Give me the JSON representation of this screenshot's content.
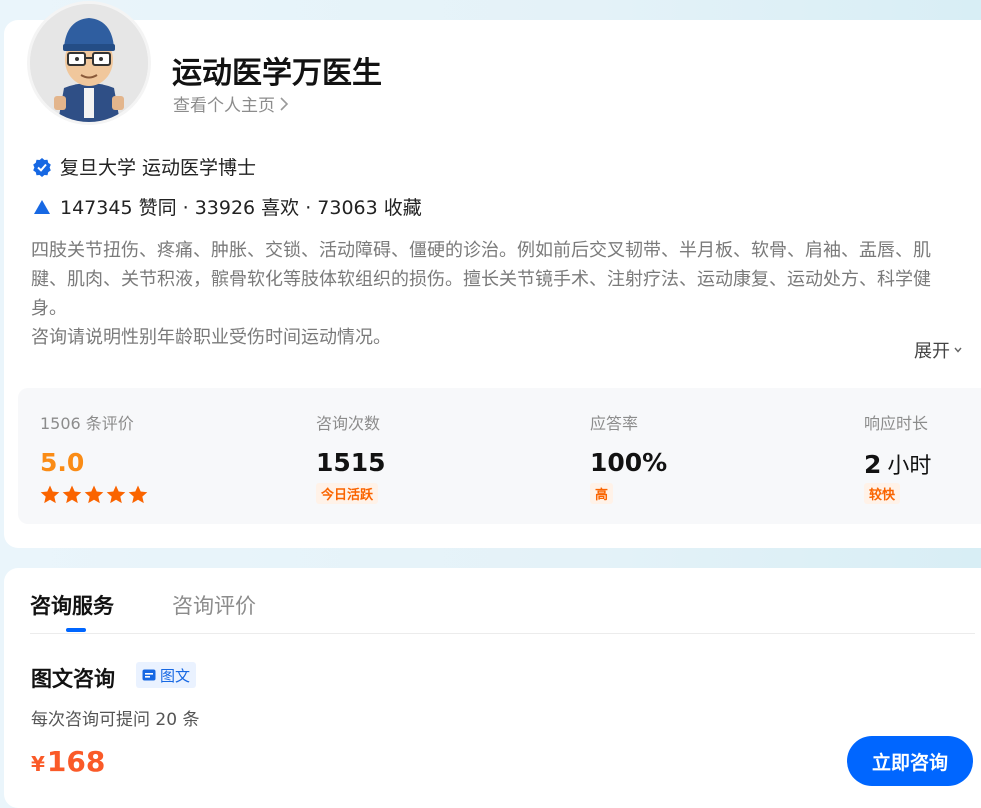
{
  "profile": {
    "name": "运动医学万医生",
    "homepage_link": "查看个人主页",
    "credential": "复旦大学 运动医学博士",
    "stats_line": "147345 赞同 · 33926 喜欢 · 73063 收藏",
    "description": "四肢关节扭伤、疼痛、肿胀、交锁、活动障碍、僵硬的诊治。例如前后交叉韧带、半月板、软骨、肩袖、盂唇、肌腱、肌肉、关节积液，髌骨软化等肢体软组织的损伤。擅长关节镜手术、注射疗法、运动康复、运动处方、科学健身。",
    "note": "咨询请说明性别年龄职业受伤时间运动情况。",
    "expand_label": "展开"
  },
  "stats": {
    "reviews": {
      "label": "1506 条评价",
      "value": "5.0",
      "stars": 5
    },
    "consults": {
      "label": "咨询次数",
      "value": "1515",
      "tag": "今日活跃"
    },
    "answer_rate": {
      "label": "应答率",
      "value": "100%",
      "tag": "高"
    },
    "response_time": {
      "label": "响应时长",
      "value": "2",
      "unit": "小时",
      "tag": "较快"
    }
  },
  "tabs": [
    {
      "label": "咨询服务",
      "active": true
    },
    {
      "label": "咨询评价",
      "active": false
    }
  ],
  "service": {
    "title": "图文咨询",
    "badge": "图文",
    "subtitle": "每次咨询可提问 20 条",
    "currency": "¥",
    "price": "168",
    "cta_label": "立即咨询"
  },
  "icons": {
    "verified": "verified-check-icon",
    "agree": "triangle-up-icon",
    "star": "star-icon",
    "chevron_right": "chevron-right-icon",
    "chevron_down": "chevron-down-icon",
    "image_text": "image-text-icon"
  },
  "colors": {
    "accent": "#0066ff",
    "price": "#fa5a28",
    "star": "#fa6400",
    "rating": "#fa8c16",
    "tag_bg": "#fff2e8"
  }
}
